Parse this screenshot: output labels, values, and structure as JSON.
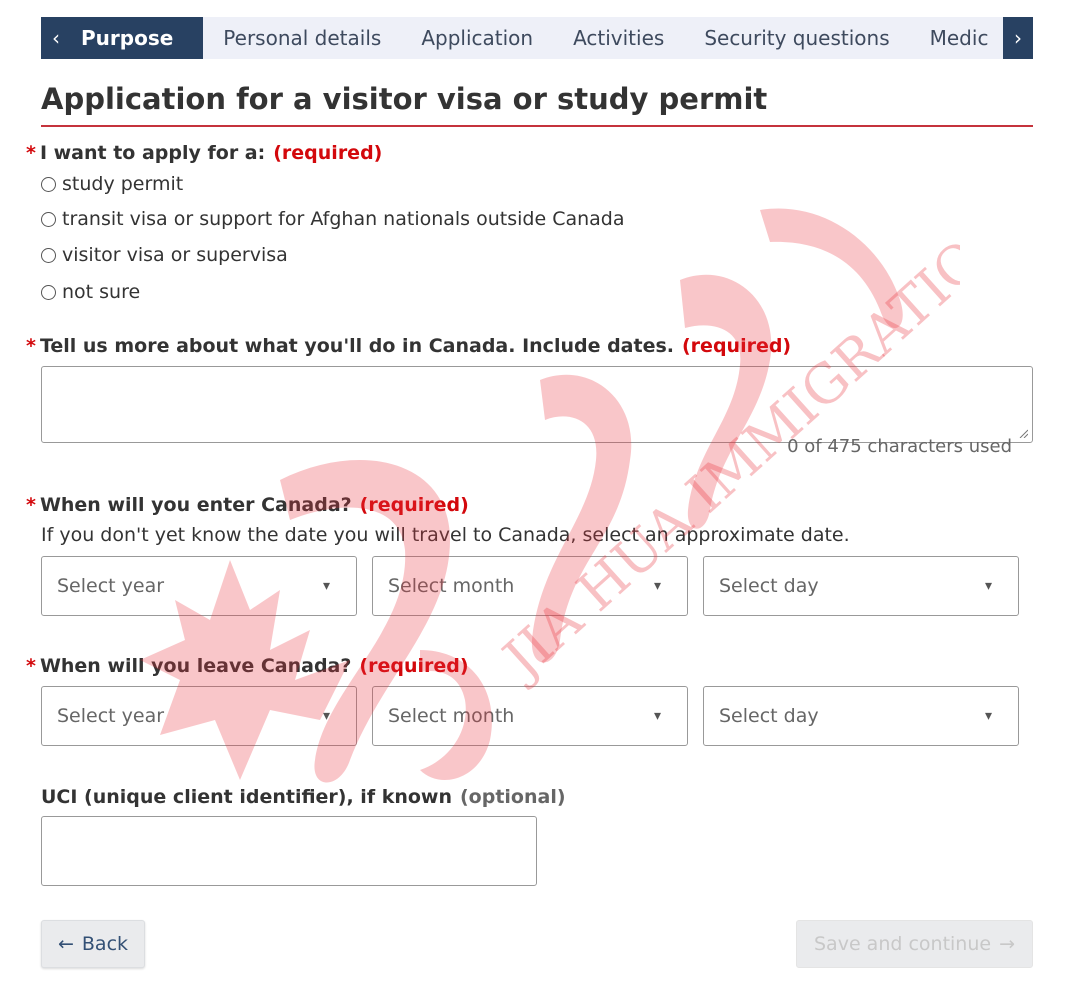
{
  "tabs": {
    "prev_icon": "‹",
    "next_icon": "›",
    "items": [
      {
        "label": "Purpose",
        "active": true
      },
      {
        "label": "Personal details"
      },
      {
        "label": "Application"
      },
      {
        "label": "Activities"
      },
      {
        "label": "Security questions"
      },
      {
        "label": "Medic"
      }
    ]
  },
  "page": {
    "title": "Application for a visitor visa or study permit",
    "accent_color": "#c5333c"
  },
  "q1": {
    "label": "I want to apply for a:",
    "required": "(required)",
    "options": [
      "study permit",
      "transit visa or support for Afghan nationals outside Canada",
      "visitor visa or supervisa",
      "not sure"
    ]
  },
  "q2": {
    "label": "Tell us more about what you'll do in Canada. Include dates.",
    "required": "(required)",
    "value": "",
    "counter": "0 of 475 characters used"
  },
  "q3": {
    "label": "When will you enter Canada?",
    "required": "(required)",
    "hint": "If you don't yet know the date you will travel to Canada, select an approximate date.",
    "year": "Select year",
    "month": "Select month",
    "day": "Select day"
  },
  "q4": {
    "label": "When will you leave Canada?",
    "required": "(required)",
    "year": "Select year",
    "month": "Select month",
    "day": "Select day"
  },
  "uci": {
    "label": "UCI (unique client identifier), if known",
    "optional": "(optional)",
    "value": ""
  },
  "buttons": {
    "back": "Back",
    "back_icon": "←",
    "save": "Save and continue",
    "save_icon": "→"
  },
  "watermark": {
    "text_cn": "加华移民",
    "text_en": "JIA HUA IMMIGRATION",
    "color": "#e8323c"
  }
}
